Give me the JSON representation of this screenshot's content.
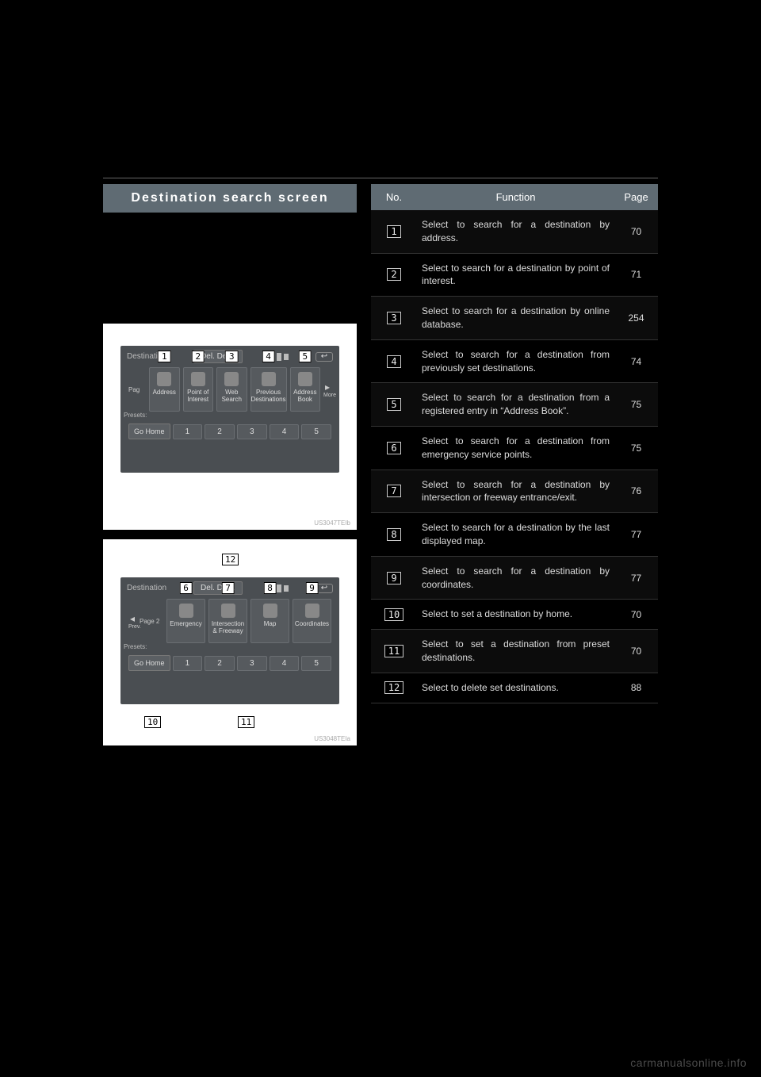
{
  "section_title": "Destination search screen",
  "shot1": {
    "title": "Destination",
    "del_dest": "Del. Dest.",
    "page_label": "Pag",
    "buttons": [
      {
        "callout": "1",
        "label": "Address"
      },
      {
        "callout": "2",
        "label": "Point of\nInterest"
      },
      {
        "callout": "3",
        "label": "Web\nSearch"
      },
      {
        "callout": "4",
        "label": "Previous\nDestinations"
      },
      {
        "callout": "5",
        "label": "Address\nBook"
      }
    ],
    "more": "More",
    "presets_label": "Presets:",
    "go_home": "Go Home",
    "preset_nums": [
      "1",
      "2",
      "3",
      "4",
      "5"
    ],
    "img_id": "US3047TEIb"
  },
  "shot2": {
    "title": "Destination",
    "del_dest": "Del. Dest.",
    "page_label": "Page 2",
    "callout_top": "12",
    "buttons": [
      {
        "callout": "6",
        "label": "Emergency"
      },
      {
        "callout": "7",
        "label": "Intersection\n& Freeway"
      },
      {
        "callout": "8",
        "label": "Map"
      },
      {
        "callout": "9",
        "label": "Coordinates"
      }
    ],
    "prev": "Prev.",
    "presets_label": "Presets:",
    "go_home": "Go Home",
    "preset_nums": [
      "1",
      "2",
      "3",
      "4",
      "5"
    ],
    "callout_gohome": "10",
    "callout_presets": "11",
    "img_id": "US3048TEIa"
  },
  "table": {
    "head": {
      "no": "No.",
      "fn": "Function",
      "pg": "Page"
    },
    "rows": [
      {
        "no": "1",
        "fn": "Select to search for a destination by address.",
        "pg": "70"
      },
      {
        "no": "2",
        "fn": "Select to search for a destination by point of interest.",
        "pg": "71"
      },
      {
        "no": "3",
        "fn": "Select to search for a destination by online database.",
        "pg": "254"
      },
      {
        "no": "4",
        "fn": "Select to search for a destination from previously set destinations.",
        "pg": "74"
      },
      {
        "no": "5",
        "fn": "Select to search for a destination from a registered entry in “Address Book”.",
        "pg": "75"
      },
      {
        "no": "6",
        "fn": "Select to search for a destination from emergency service points.",
        "pg": "75"
      },
      {
        "no": "7",
        "fn": "Select to search for a destination by intersection or freeway entrance/exit.",
        "pg": "76"
      },
      {
        "no": "8",
        "fn": "Select to search for a destination by the last displayed map.",
        "pg": "77"
      },
      {
        "no": "9",
        "fn": "Select to search for a destination by coordinates.",
        "pg": "77"
      },
      {
        "no": "10",
        "fn": "Select to set a destination by home.",
        "pg": "70"
      },
      {
        "no": "11",
        "fn": "Select to set a destination from preset destinations.",
        "pg": "70"
      },
      {
        "no": "12",
        "fn": "Select to delete set destinations.",
        "pg": "88"
      }
    ]
  },
  "watermark": "carmanualsonline.info"
}
